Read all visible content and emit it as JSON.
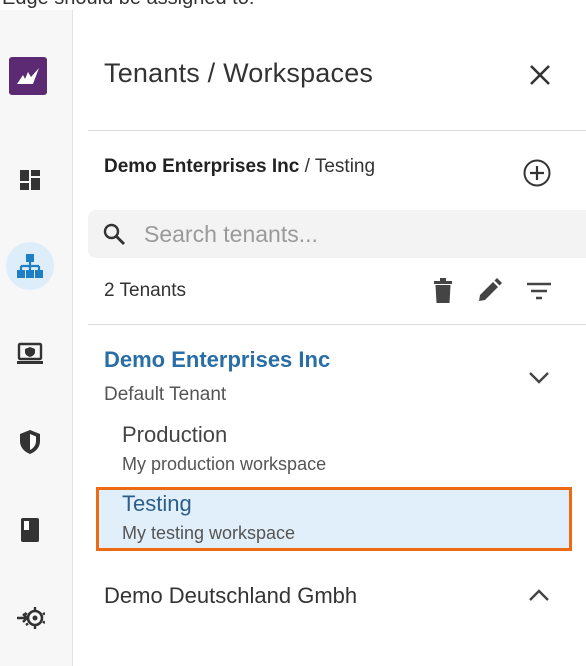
{
  "top_caption": "Edge should be assigned to:",
  "rail": {
    "items": [
      {
        "icon": "dashboard-icon"
      },
      {
        "icon": "hierarchy-icon",
        "active": true
      },
      {
        "icon": "monitor-shield-icon"
      },
      {
        "icon": "shield-icon"
      },
      {
        "icon": "book-icon"
      },
      {
        "icon": "gear-arrow-icon"
      }
    ]
  },
  "panel": {
    "title": "Tenants / Workspaces",
    "breadcrumb": {
      "tenant": "Demo Enterprises Inc",
      "separator": " / ",
      "workspace": "Testing"
    },
    "search": {
      "placeholder": "Search tenants..."
    },
    "count_label": "2 Tenants"
  },
  "tenants": [
    {
      "name": "Demo Enterprises Inc",
      "description": "Default Tenant",
      "expanded": true,
      "workspaces": [
        {
          "name": "Production",
          "description": "My production workspace",
          "selected": false
        },
        {
          "name": "Testing",
          "description": "My testing workspace",
          "selected": true
        }
      ]
    },
    {
      "name": "Demo Deutschland Gmbh",
      "expanded": false
    }
  ],
  "colors": {
    "brand": "#5b2a73",
    "accent_blue": "#2a6ea6",
    "selection_border": "#ec6a14",
    "selection_fill": "#e1effa"
  }
}
